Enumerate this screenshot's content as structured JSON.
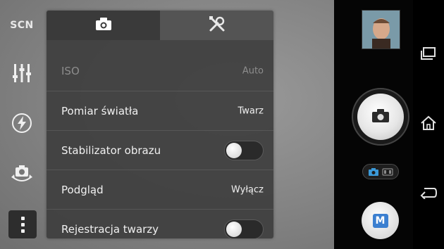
{
  "left_rail": {
    "scene_label": "SCN",
    "icons": [
      "settings-sliders-icon",
      "flash-auto-icon",
      "switch-camera-icon",
      "more-vert-icon"
    ]
  },
  "menu": {
    "tabs": [
      {
        "icon": "camera-icon",
        "active": true
      },
      {
        "icon": "tools-icon",
        "active": false
      }
    ],
    "rows": [
      {
        "label": "ISO",
        "value": "Auto",
        "type": "value",
        "disabled": true
      },
      {
        "label": "Pomiar światła",
        "value": "Twarz",
        "type": "value",
        "disabled": false
      },
      {
        "label": "Stabilizator obrazu",
        "value": "",
        "type": "toggle",
        "on": false
      },
      {
        "label": "Podgląd",
        "value": "Wyłącz",
        "type": "value",
        "disabled": false
      },
      {
        "label": "Rejestracja twarzy",
        "value": "",
        "type": "toggle",
        "on": false
      }
    ]
  },
  "right_panel": {
    "manual_mode_label": "M",
    "icons": [
      "last-photo-thumbnail",
      "shutter-camera-icon",
      "photo-video-switch-icon",
      "manual-mode-icon"
    ]
  },
  "navbar": {
    "icons": [
      "recent-apps-icon",
      "home-icon",
      "back-icon"
    ]
  },
  "colors": {
    "accent_blue": "#3b7fd0",
    "menu_bg": "#3e3e3e"
  }
}
